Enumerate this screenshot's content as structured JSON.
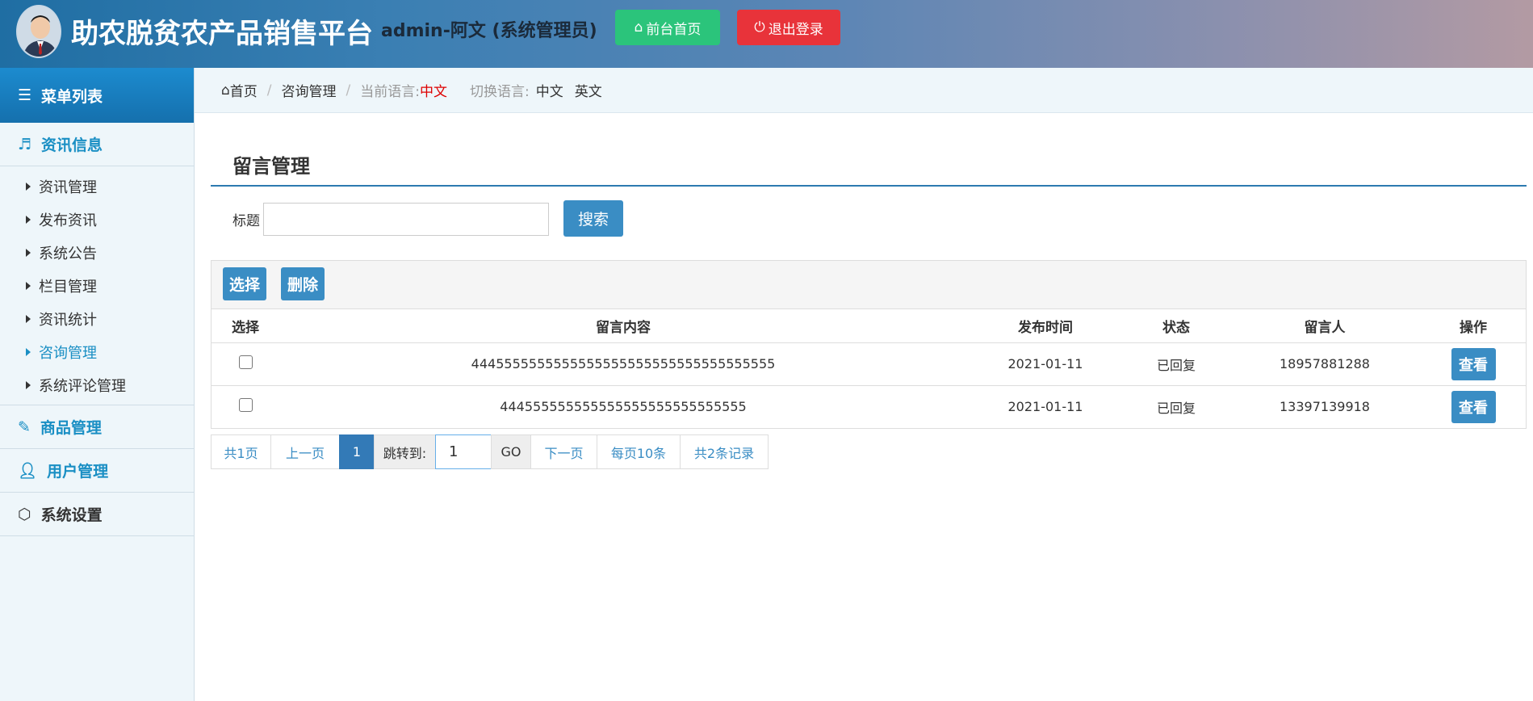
{
  "header": {
    "site_title": "助农脱贫农产品销售平台",
    "admin_label": "admin-阿文 (系统管理员)",
    "home_button": "前台首页",
    "logout_button": "退出登录"
  },
  "sidebar": {
    "menu_title": "菜单列表",
    "group_info": "资讯信息",
    "items": [
      "资讯管理",
      "发布资讯",
      "系统公告",
      "栏目管理",
      "资讯统计",
      "咨询管理",
      "系统评论管理"
    ],
    "group_goods": "商品管理",
    "group_users": "用户管理",
    "group_settings": "系统设置"
  },
  "breadcrumb": {
    "home": "首页",
    "current": "咨询管理",
    "lang_label": "当前语言:",
    "lang_value": "中文",
    "switch_label": "切换语言:",
    "lang_cn": "中文",
    "lang_en": "英文"
  },
  "main": {
    "page_title": "留言管理",
    "search_label": "标题",
    "search_value": "",
    "search_button": "搜索",
    "select_button": "选择",
    "delete_button": "删除"
  },
  "table": {
    "headers": [
      "选择",
      "留言内容",
      "发布时间",
      "状态",
      "留言人",
      "操作"
    ],
    "rows": [
      {
        "content": "4445555555555555555555555555555555555",
        "date": "2021-01-11",
        "status": "已回复",
        "user": "18957881288",
        "action": "查看"
      },
      {
        "content": "444555555555555555555555555555",
        "date": "2021-01-11",
        "status": "已回复",
        "user": "13397139918",
        "action": "查看"
      }
    ]
  },
  "pager": {
    "total_pages": "共1页",
    "prev": "上一页",
    "current": "1",
    "jump_label": "跳转到:",
    "jump_value": "1",
    "go": "GO",
    "next": "下一页",
    "per_page": "每页10条",
    "total_records": "共2条记录"
  },
  "colors": {
    "accent": "#3a8dc4",
    "home_button": "#2bc47b",
    "logout_button": "#e8333a",
    "sidebar_active": "#1a8fc4"
  }
}
